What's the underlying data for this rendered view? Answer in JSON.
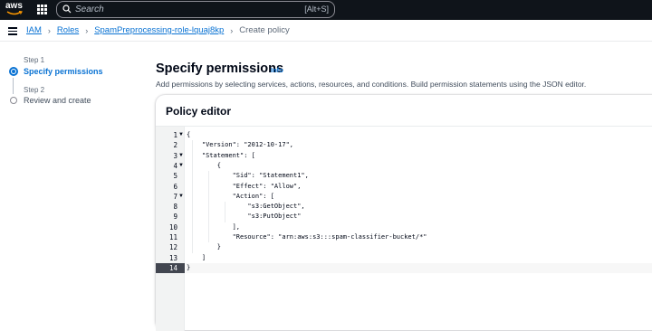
{
  "topbar": {
    "logo_text": "aws",
    "search_placeholder": "Search",
    "search_shortcut": "[Alt+S]"
  },
  "breadcrumb": {
    "items": [
      "IAM",
      "Roles",
      "SpamPreprocessing-role-lquaj8kp"
    ],
    "current": "Create policy"
  },
  "wizard": {
    "steps": [
      {
        "step": "Step 1",
        "label": "Specify permissions",
        "state": "active"
      },
      {
        "step": "Step 2",
        "label": "Review and create",
        "state": "inactive"
      }
    ]
  },
  "main": {
    "title": "Specify permissions",
    "info": "Info",
    "description": "Add permissions by selecting services, actions, resources, and conditions. Build permission statements using the JSON editor."
  },
  "policy_editor": {
    "title": "Policy editor",
    "active_line": 14,
    "lines": [
      {
        "n": "1",
        "fold": "▼",
        "text": "{"
      },
      {
        "n": "2",
        "fold": "",
        "text": "    \"Version\": \"2012-10-17\","
      },
      {
        "n": "3",
        "fold": "▼",
        "text": "    \"Statement\": ["
      },
      {
        "n": "4",
        "fold": "▼",
        "text": "        {"
      },
      {
        "n": "5",
        "fold": "",
        "text": "            \"Sid\": \"Statement1\","
      },
      {
        "n": "6",
        "fold": "",
        "text": "            \"Effect\": \"Allow\","
      },
      {
        "n": "7",
        "fold": "▼",
        "text": "            \"Action\": ["
      },
      {
        "n": "8",
        "fold": "",
        "text": "                \"s3:GetObject\","
      },
      {
        "n": "9",
        "fold": "",
        "text": "                \"s3:PutObject\""
      },
      {
        "n": "10",
        "fold": "",
        "text": "            ],"
      },
      {
        "n": "11",
        "fold": "",
        "text": "            \"Resource\": \"arn:aws:s3:::spam-classifier-bucket/*\""
      },
      {
        "n": "12",
        "fold": "",
        "text": "        }"
      },
      {
        "n": "13",
        "fold": "",
        "text": "    ]"
      },
      {
        "n": "14",
        "fold": "",
        "text": "}"
      }
    ]
  },
  "colors": {
    "topbar_bg": "#0f141a",
    "link": "#0972d3",
    "active_gutter": "#424650"
  }
}
